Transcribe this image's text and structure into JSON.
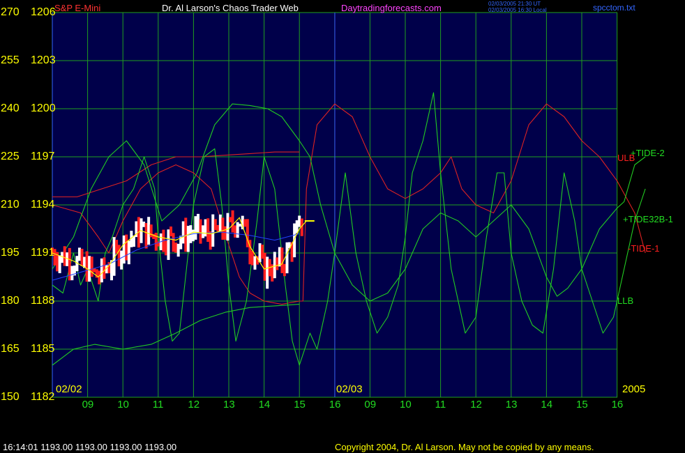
{
  "header": {
    "instrument": "S&P E-Mini",
    "title": "Dr. Al Larson's Chaos Trader Web",
    "site": "Daytradingforecasts.com",
    "time_ut": "02/03/2005 21:30 UT",
    "time_local": "02/03/2005 16:30 Local",
    "file": "spcctom.txt"
  },
  "footer": {
    "quote": "16:14:01  1193.00 1193.00 1193.00 1193.00",
    "copyright": "Copyright 2004, Dr. Al Larson. May not be copied by any means."
  },
  "chart_data": {
    "type": "line",
    "y_axis_left_tide": {
      "ticks": [
        "270",
        "255",
        "240",
        "225",
        "210",
        "195",
        "180",
        "165",
        "150"
      ]
    },
    "y_axis_price": {
      "ticks": [
        "1206",
        "1203",
        "1200",
        "1197",
        "1194",
        "1191",
        "1188",
        "1185",
        "1182"
      ],
      "range": [
        1182,
        1206
      ]
    },
    "x_axis": {
      "hour_ticks": [
        "09",
        "10",
        "11",
        "12",
        "13",
        "14",
        "15",
        "16",
        "09",
        "10",
        "11",
        "12",
        "13",
        "14",
        "15",
        "16"
      ],
      "date_labels": [
        "02/02",
        "02/03"
      ],
      "year": "2005"
    },
    "legend": {
      "tide_2": "+TIDE-2",
      "ulb": "ULB",
      "tide32b_1": "+TIDE32B-1",
      "tide_1": "-TIDE-1",
      "llb": "LLB"
    },
    "colors": {
      "background": "#00004a",
      "grid": "#1f9f1f",
      "tide_2": "#22cc22",
      "tide32b_1": "#22cc22",
      "tide_1": "#dd2222",
      "ulb": "#dd2222",
      "llb": "#22cc22",
      "price_up": "#ffffff",
      "price_down": "#ff2020",
      "ema_fast": "#ffff00",
      "ema_slow": "#2244ff"
    },
    "series_points": {
      "tide_2": [
        [
          0,
          1190
        ],
        [
          0.6,
          1192
        ],
        [
          1.1,
          1195
        ],
        [
          1.6,
          1197
        ],
        [
          2.1,
          1198
        ],
        [
          2.6,
          1196.5
        ],
        [
          3.1,
          1193
        ],
        [
          3.6,
          1194
        ],
        [
          4.1,
          1196
        ],
        [
          4.6,
          1199
        ],
        [
          5.1,
          1200.3
        ],
        [
          5.6,
          1200.2
        ],
        [
          6.1,
          1200
        ],
        [
          6.5,
          1199.5
        ],
        [
          7,
          1198
        ],
        [
          7.3,
          1197
        ],
        [
          7.6,
          1194
        ],
        [
          8,
          1191
        ],
        [
          8.5,
          1189
        ],
        [
          9,
          1188
        ],
        [
          9.5,
          1188.5
        ],
        [
          10,
          1190
        ],
        [
          10.5,
          1192.5
        ],
        [
          11,
          1193.5
        ],
        [
          11.5,
          1193
        ],
        [
          12,
          1192
        ],
        [
          12.5,
          1193
        ],
        [
          13,
          1194
        ],
        [
          13.5,
          1192.5
        ],
        [
          14,
          1189.5
        ],
        [
          14.3,
          1188.3
        ],
        [
          14.6,
          1188.8
        ],
        [
          15,
          1190
        ],
        [
          15.5,
          1192.5
        ],
        [
          16,
          1193.8
        ],
        [
          16.2,
          1194.2
        ],
        [
          16.5,
          1196.5
        ],
        [
          16.8,
          1197
        ]
      ],
      "tide32b_1": [
        [
          0,
          1189
        ],
        [
          0.3,
          1188.5
        ],
        [
          0.6,
          1191
        ],
        [
          0.8,
          1189
        ],
        [
          1,
          1190
        ],
        [
          1.3,
          1188
        ],
        [
          1.5,
          1191
        ],
        [
          1.7,
          1192
        ],
        [
          2,
          1194
        ],
        [
          2.3,
          1195
        ],
        [
          2.6,
          1197
        ],
        [
          2.9,
          1195
        ],
        [
          3,
          1192
        ],
        [
          3.2,
          1188
        ],
        [
          3.4,
          1185.5
        ],
        [
          3.6,
          1186
        ],
        [
          3.8,
          1190
        ],
        [
          4,
          1194
        ],
        [
          4.3,
          1197
        ],
        [
          4.6,
          1197.5
        ],
        [
          4.8,
          1194
        ],
        [
          5,
          1189
        ],
        [
          5.2,
          1185.5
        ],
        [
          5.5,
          1188
        ],
        [
          5.8,
          1193
        ],
        [
          6,
          1197
        ],
        [
          6.3,
          1195
        ],
        [
          6.6,
          1189
        ],
        [
          6.8,
          1185.5
        ],
        [
          7,
          1184
        ],
        [
          7.3,
          1186
        ],
        [
          7.5,
          1185
        ],
        [
          7.8,
          1188
        ],
        [
          8,
          1191
        ],
        [
          8.3,
          1196
        ],
        [
          8.6,
          1191
        ],
        [
          8.9,
          1188
        ],
        [
          9.2,
          1186
        ],
        [
          9.5,
          1187
        ],
        [
          9.8,
          1189
        ],
        [
          10,
          1192
        ],
        [
          10.2,
          1196
        ],
        [
          10.5,
          1198
        ],
        [
          10.8,
          1201
        ],
        [
          11,
          1196
        ],
        [
          11.3,
          1190
        ],
        [
          11.5,
          1188
        ],
        [
          11.7,
          1186
        ],
        [
          12,
          1187
        ],
        [
          12.3,
          1192
        ],
        [
          12.6,
          1196
        ],
        [
          12.8,
          1196
        ],
        [
          13,
          1191
        ],
        [
          13.3,
          1188
        ],
        [
          13.6,
          1186.5
        ],
        [
          13.9,
          1186
        ],
        [
          14.2,
          1190
        ],
        [
          14.5,
          1196
        ],
        [
          14.8,
          1193
        ],
        [
          15,
          1190
        ],
        [
          15.3,
          1188
        ],
        [
          15.6,
          1186
        ],
        [
          15.9,
          1187
        ],
        [
          16.2,
          1190
        ],
        [
          16.5,
          1193
        ],
        [
          16.8,
          1195
        ]
      ],
      "tide_1": [
        [
          0,
          1194
        ],
        [
          0.8,
          1193.5
        ],
        [
          1.3,
          1192
        ],
        [
          1.6,
          1191
        ],
        [
          2,
          1193
        ],
        [
          2.5,
          1195
        ],
        [
          3,
          1196
        ],
        [
          3.5,
          1196.5
        ],
        [
          4,
          1196
        ],
        [
          4.5,
          1195
        ],
        [
          5,
          1191.5
        ],
        [
          5.3,
          1189.5
        ],
        [
          5.6,
          1188.5
        ],
        [
          6,
          1188
        ],
        [
          6.5,
          1187.8
        ],
        [
          7,
          1188
        ],
        [
          7.1,
          1188
        ],
        [
          7.2,
          1195
        ],
        [
          7.5,
          1199
        ],
        [
          8,
          1200.3
        ],
        [
          8.5,
          1199.5
        ],
        [
          9,
          1197
        ],
        [
          9.5,
          1195
        ],
        [
          10,
          1194.4
        ],
        [
          10.5,
          1195
        ],
        [
          11,
          1196
        ],
        [
          11.3,
          1197
        ],
        [
          11.6,
          1195
        ],
        [
          12,
          1194
        ],
        [
          12.5,
          1193.5
        ],
        [
          13,
          1195.5
        ],
        [
          13.5,
          1199
        ],
        [
          14,
          1200.3
        ],
        [
          14.5,
          1199.5
        ],
        [
          15,
          1198
        ],
        [
          15.5,
          1197
        ],
        [
          16,
          1195.5
        ],
        [
          16.5,
          1193.5
        ],
        [
          16.8,
          1191
        ]
      ],
      "ulb": [
        [
          0,
          1194.5
        ],
        [
          0.7,
          1194.5
        ],
        [
          1.4,
          1195
        ],
        [
          2.1,
          1195.5
        ],
        [
          2.8,
          1196.5
        ],
        [
          3.5,
          1197
        ],
        [
          4.2,
          1197
        ],
        [
          4.9,
          1197.1
        ],
        [
          5.6,
          1197.2
        ],
        [
          6.3,
          1197.3
        ],
        [
          7,
          1197.3
        ]
      ],
      "llb": [
        [
          0,
          1184
        ],
        [
          0.6,
          1185
        ],
        [
          1.2,
          1185.3
        ],
        [
          2,
          1185
        ],
        [
          2.8,
          1185.3
        ],
        [
          3.5,
          1186
        ],
        [
          4.2,
          1186.8
        ],
        [
          4.9,
          1187.3
        ],
        [
          5.6,
          1187.6
        ],
        [
          6.3,
          1187.7
        ],
        [
          7,
          1187.8
        ]
      ]
    },
    "price_bars_end": 1193,
    "ema_fast_points": [
      [
        0,
        1191
      ],
      [
        0.6,
        1190.5
      ],
      [
        1,
        1190
      ],
      [
        1.3,
        1189.5
      ],
      [
        1.6,
        1190.2
      ],
      [
        2,
        1191.5
      ],
      [
        2.5,
        1192.4
      ],
      [
        3,
        1192
      ],
      [
        3.5,
        1191.8
      ],
      [
        4,
        1192.3
      ],
      [
        4.5,
        1192.2
      ],
      [
        5,
        1192.5
      ],
      [
        5.3,
        1193.2
      ],
      [
        5.6,
        1191.4
      ],
      [
        6,
        1190
      ],
      [
        6.5,
        1190.3
      ],
      [
        7,
        1192.5
      ],
      [
        7.2,
        1193
      ]
    ],
    "ema_slow_points": [
      [
        0,
        1189.3
      ],
      [
        0.8,
        1189.8
      ],
      [
        1.6,
        1190.3
      ],
      [
        2.4,
        1191.2
      ],
      [
        3.2,
        1191.8
      ],
      [
        4,
        1192.2
      ],
      [
        4.8,
        1192.3
      ],
      [
        5.6,
        1192.1
      ],
      [
        6.3,
        1191.8
      ],
      [
        7,
        1192.2
      ]
    ]
  }
}
